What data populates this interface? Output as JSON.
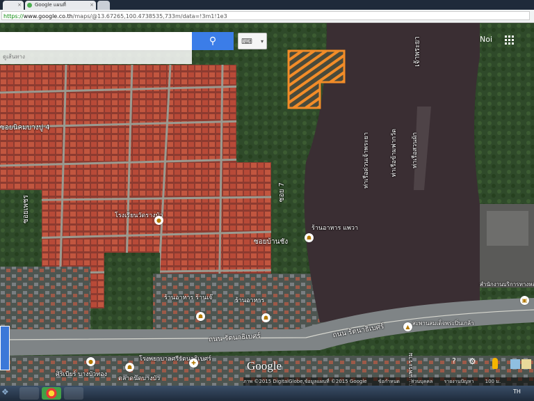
{
  "browser": {
    "tabs": [
      {
        "label": "Google แผนที่"
      },
      {
        "label": ""
      }
    ],
    "url_scheme": "https://",
    "url_host": "www.google.co.th",
    "url_path": "/maps/@13.67265,100.4738535,733m/data=!3m1!1e3"
  },
  "search": {
    "placeholder": "",
    "hint": "ดูเส้นทาง"
  },
  "header": {
    "signin_label": "Noi"
  },
  "map_labels": {
    "river": "เจ้าพระยา",
    "road_left": "ซอยนิคมบางปู 4",
    "road_vertical_left": "ซอยเพชร",
    "school": "โรงเรียนวัดรางบัว",
    "soi_7": "ซอย 7",
    "soi_area": "ซอยบ้านชัง",
    "restaurant_1": "ร้านอาหาร แพวา",
    "restaurant_2": "ร้านอาหาร ร้านเจ๊",
    "restaurant_3": "ร้านอาหาร",
    "temple": "สำนักงานบริการทางหลวงพิเศษ",
    "bridge_pier": "ท่าเรือด่วนเจ้าพระยา",
    "ferry_1": "ท่าเรือข้ามฟากวัด",
    "ferry_2": "ท่าเรือสวนผัก",
    "main_road_1": "ถนน รัตนาธิเบศร์",
    "main_road_2": "ถนน รัตนาธิเบศร์",
    "bridge": "สะพานสมเด็จพระปิ่นเกล้า",
    "school_2": "โรงพยาบาลศรีรัตนาธิเบศร์",
    "market": "ตลาดนัดบางบัว",
    "bottom_place": "ศิริเบียร์ บางบัวทอง",
    "vertical_road_right": "ถนนพระราม"
  },
  "footer": {
    "logo": "Google",
    "attribution": "ภาพ ©2015 DigitalGlobe,ข้อมูลแผนที่ ©2015 Google",
    "terms": "ข้อกำหนด",
    "privacy": "ส่วนบุคคล",
    "report": "รายงานปัญหา",
    "scale": "100 ม."
  },
  "tray": {
    "text": "TH"
  },
  "icons": {
    "search": "search-icon",
    "keyboard": "keyboard-icon",
    "apps": "apps-grid-icon",
    "pegman": "pegman-icon",
    "settings": "gear-icon"
  },
  "colors": {
    "accent": "#3b7de8",
    "highlight": "#f28c28",
    "water": "#3a2e33",
    "roofs": "#b8503e"
  }
}
